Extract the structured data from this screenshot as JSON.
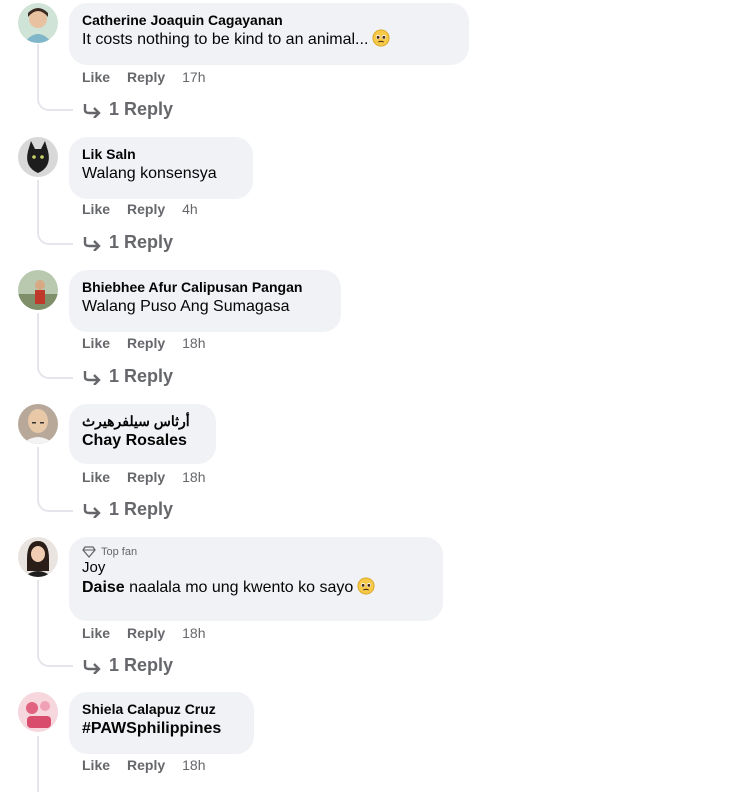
{
  "comments": [
    {
      "author": "Catherine Joaquin Cagayanan",
      "text": "It costs nothing to be kind to an animal...",
      "emoji": "pleading-face",
      "actions": {
        "like": "Like",
        "reply": "Reply",
        "time": "17h"
      },
      "replies": "1 Reply",
      "avatar": "woman-avatar"
    },
    {
      "author": "Lik Saln",
      "text": "Walang konsensya",
      "actions": {
        "like": "Like",
        "reply": "Reply",
        "time": "4h"
      },
      "replies": "1 Reply",
      "avatar": "cat-avatar"
    },
    {
      "author": "Bhiebhee Afur Calipusan Pangan",
      "text": "Walang Puso Ang Sumagasa",
      "actions": {
        "like": "Like",
        "reply": "Reply",
        "time": "18h"
      },
      "replies": "1 Reply",
      "avatar": "photo-avatar"
    },
    {
      "author": "أرثاس سيلفرهيرث",
      "mention": "Chay Rosales",
      "actions": {
        "like": "Like",
        "reply": "Reply",
        "time": "18h"
      },
      "replies": "1 Reply",
      "avatar": "bald-man-avatar"
    },
    {
      "badge": "Top fan",
      "author": "Joy",
      "mention": "Daise",
      "text": " naalala mo ung kwento ko sayo",
      "emoji": "pleading-face",
      "actions": {
        "like": "Like",
        "reply": "Reply",
        "time": "18h"
      },
      "replies": "1 Reply",
      "avatar": "woman-avatar"
    },
    {
      "author": "Shiela Calapuz Cruz",
      "mention": "#PAWSphilippines",
      "actions": {
        "like": "Like",
        "reply": "Reply",
        "time": "18h"
      },
      "avatar": "pink-photo-avatar"
    }
  ],
  "colors": {
    "bubble": "#f0f2f5",
    "secondary_text": "#65676b",
    "thread_line": "#e4e6eb"
  }
}
